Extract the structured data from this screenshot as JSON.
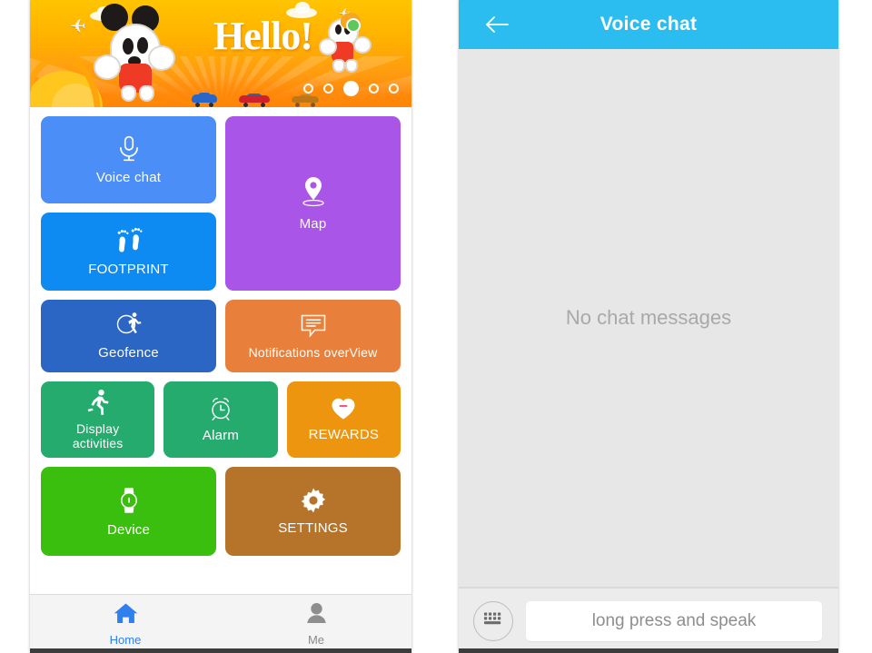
{
  "home": {
    "banner": {
      "greeting": "Hello!",
      "pager": {
        "count": 5,
        "active_index": 2
      },
      "icons": [
        "airplane-icon",
        "cloud-icon",
        "mascot-icon",
        "car-icon"
      ]
    },
    "tiles": [
      {
        "id": "voice-chat",
        "label": "Voice chat",
        "icon": "microphone-icon",
        "color": "#4c8ef7"
      },
      {
        "id": "footprint",
        "label": "FOOTPRINT",
        "icon": "footprints-icon",
        "color": "#0d8bf2"
      },
      {
        "id": "map",
        "label": "Map",
        "icon": "map-pin-icon",
        "color": "#a855e8"
      },
      {
        "id": "geofence",
        "label": "Geofence",
        "icon": "geofence-icon",
        "color": "#2b66c4"
      },
      {
        "id": "notifications",
        "label": "Notifications overView",
        "icon": "message-list-icon",
        "color": "#e8803c"
      },
      {
        "id": "display-activities",
        "label": "Display\nactivities",
        "icon": "runner-icon",
        "color": "#26ab6e"
      },
      {
        "id": "alarm",
        "label": "Alarm",
        "icon": "alarm-clock-icon",
        "color": "#26ab6e"
      },
      {
        "id": "rewards",
        "label": "REWARDS",
        "icon": "heart-icon",
        "color": "#ee9510"
      },
      {
        "id": "device",
        "label": "Device",
        "icon": "watch-icon",
        "color": "#3bbf0e"
      },
      {
        "id": "settings",
        "label": "SETTINGS",
        "icon": "gear-icon",
        "color": "#b5742a"
      }
    ],
    "tile_labels": {
      "voice_chat": "Voice chat",
      "footprint": "FOOTPRINT",
      "map": "Map",
      "geofence": "Geofence",
      "notifications": "Notifications overView",
      "display_line1": "Display",
      "display_line2": "activities",
      "alarm": "Alarm",
      "rewards": "REWARDS",
      "device": "Device",
      "settings": "SETTINGS"
    },
    "tabbar": {
      "tabs": [
        {
          "id": "home",
          "label": "Home",
          "icon": "home-icon",
          "active": true,
          "color": "#2f80ed"
        },
        {
          "id": "me",
          "label": "Me",
          "icon": "person-icon",
          "active": false,
          "color": "#8a8a8a"
        }
      ],
      "home_label": "Home",
      "me_label": "Me"
    }
  },
  "voice_chat": {
    "nav": {
      "title": "Voice chat",
      "back_icon": "arrow-left-icon",
      "bar_color": "#2bbdf0"
    },
    "empty_state": "No chat messages",
    "input_bar": {
      "keyboard_icon": "keyboard-icon",
      "speak_label": "long press and speak"
    }
  }
}
